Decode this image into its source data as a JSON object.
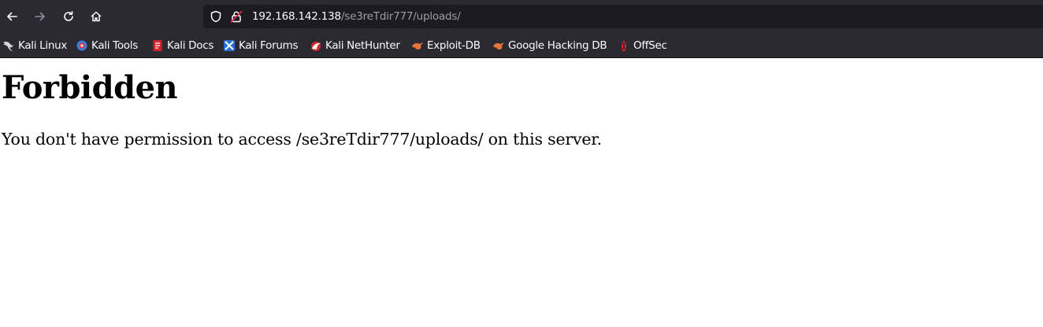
{
  "toolbar": {
    "url_host": "192.168.142.138",
    "url_path": "/se3reTdir777/uploads/",
    "icons": {
      "back": "back-arrow-icon",
      "forward": "forward-arrow-icon",
      "reload": "reload-icon",
      "home": "home-icon",
      "tracking_protection": "shield-icon",
      "connection": "insecure-lock-icon"
    }
  },
  "bookmarks": [
    {
      "label": "Kali Linux",
      "icon": "kali-dragon-icon"
    },
    {
      "label": "Kali Tools",
      "icon": "kali-tools-icon"
    },
    {
      "label": "Kali Docs",
      "icon": "kali-docs-icon"
    },
    {
      "label": "Kali Forums",
      "icon": "kali-forums-icon"
    },
    {
      "label": "Kali NetHunter",
      "icon": "kali-nethunter-icon"
    },
    {
      "label": "Exploit-DB",
      "icon": "exploit-db-icon"
    },
    {
      "label": "Google Hacking DB",
      "icon": "ghdb-icon"
    },
    {
      "label": "OffSec",
      "icon": "offsec-icon"
    }
  ],
  "page": {
    "heading": "Forbidden",
    "message": "You don't have permission to access /se3reTdir777/uploads/ on this server."
  },
  "colors": {
    "chrome_background": "#2b2a33",
    "urlbar_background": "#1c1b22",
    "chrome_text": "#fbfbfe",
    "url_path_text": "#9e9da4",
    "page_background": "#ffffff",
    "page_text": "#000000"
  }
}
